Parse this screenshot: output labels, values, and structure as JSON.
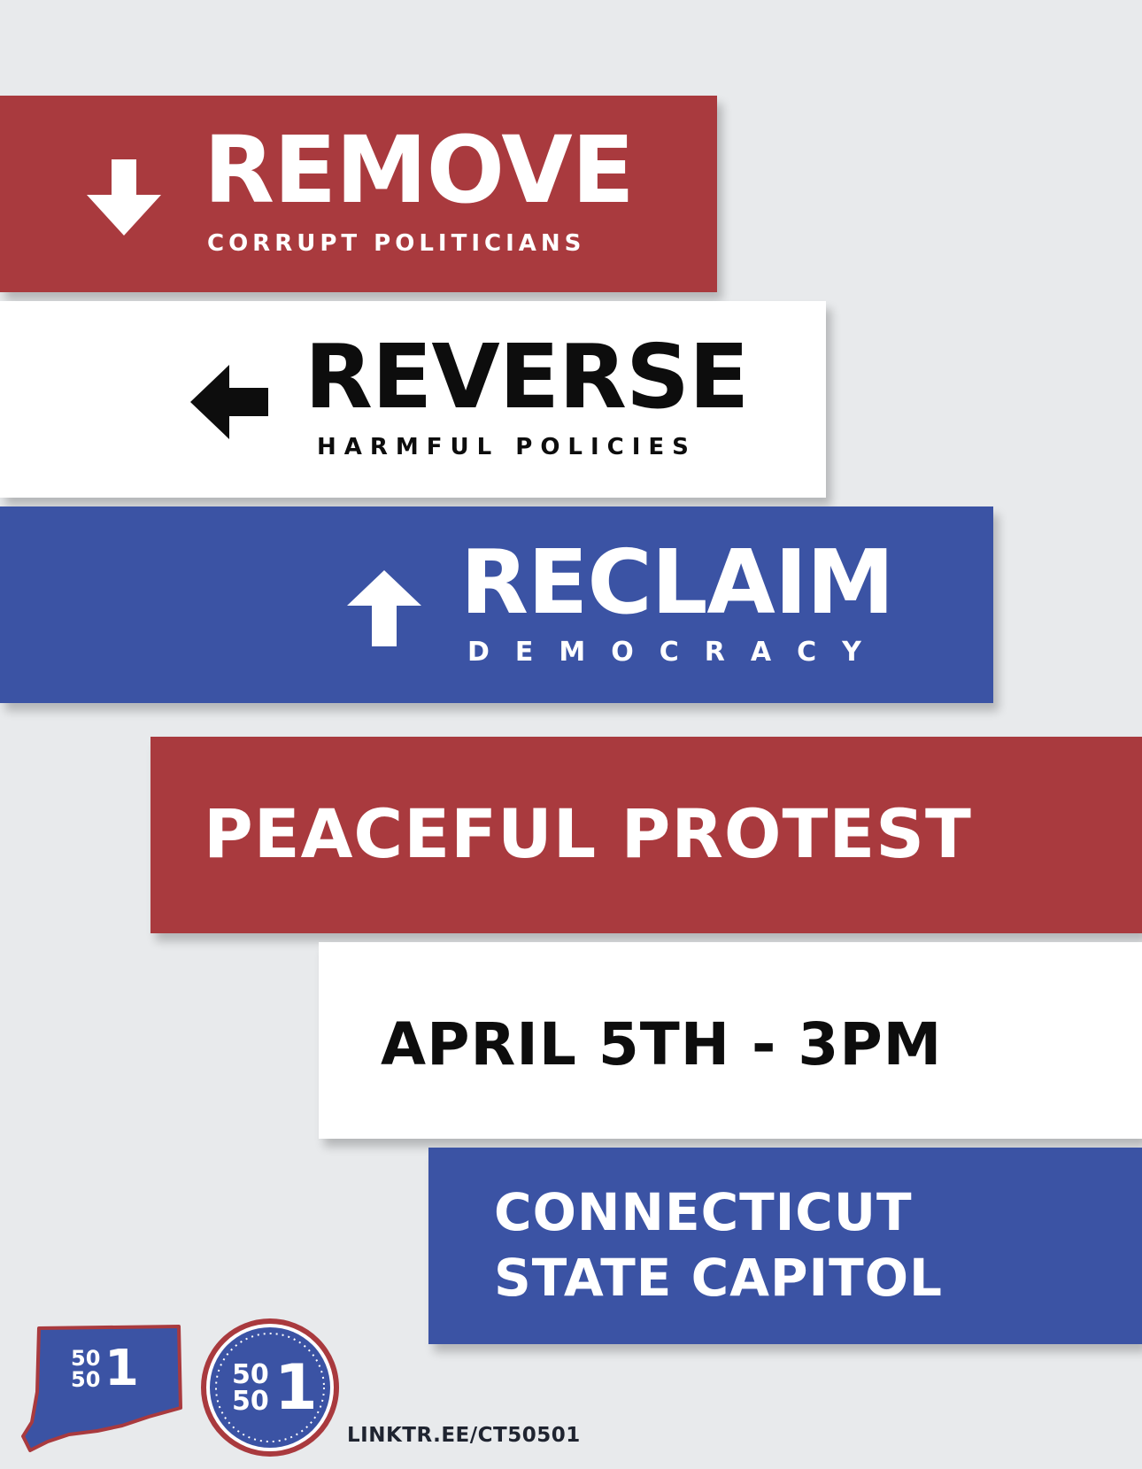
{
  "banners": {
    "remove": {
      "headline": "REMOVE",
      "subline": "CORRUPT POLITICIANS",
      "icon": "arrow-down-icon"
    },
    "reverse": {
      "headline": "REVERSE",
      "subline": "HARMFUL POLICIES",
      "icon": "arrow-left-icon"
    },
    "reclaim": {
      "headline": "RECLAIM",
      "subline": "DEMOCRACY",
      "icon": "arrow-up-icon"
    }
  },
  "event": {
    "title": "PEACEFUL PROTEST",
    "datetime": "APRIL 5TH - 3PM",
    "location_line1": "CONNECTICUT",
    "location_line2": "STATE CAPITOL"
  },
  "footer": {
    "logo_state_text_top": "50",
    "logo_state_text_bottom": "50",
    "logo_state_text_one": "1",
    "logo_circle_text_top": "50",
    "logo_circle_text_bottom": "50",
    "logo_circle_text_one": "1",
    "link": "LINKTR.EE/CT50501"
  },
  "colors": {
    "background": "#e8eaec",
    "red": "#a93a3e",
    "blue": "#3b53a4",
    "white": "#ffffff",
    "black": "#0d0d0d"
  }
}
